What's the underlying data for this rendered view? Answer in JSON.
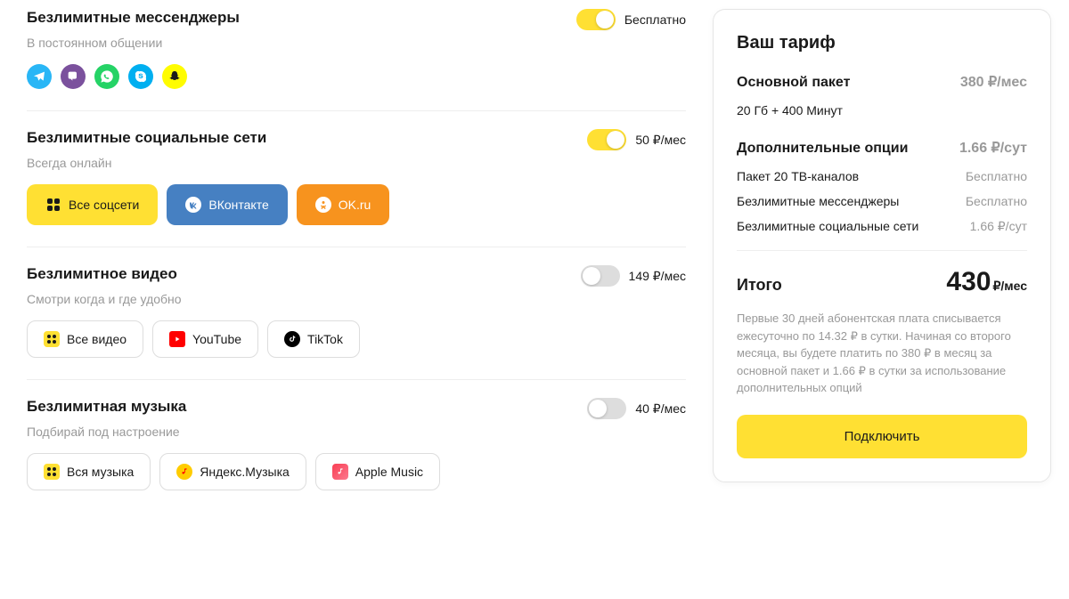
{
  "options": {
    "messengers": {
      "title": "Безлимитные мессенджеры",
      "subtitle": "В постоянном общении",
      "price": "Бесплатно",
      "enabled": true,
      "icons": [
        {
          "name": "telegram",
          "color": "#29b6f6"
        },
        {
          "name": "viber",
          "color": "#7b519d"
        },
        {
          "name": "whatsapp",
          "color": "#25d366"
        },
        {
          "name": "skype",
          "color": "#00aff0"
        },
        {
          "name": "snapchat",
          "color": "#fffc00"
        }
      ]
    },
    "social": {
      "title": "Безлимитные социальные сети",
      "subtitle": "Всегда онлайн",
      "price": "50 ₽/мес",
      "enabled": true,
      "chips": [
        {
          "label": "Все соцсети",
          "style": "yellow"
        },
        {
          "label": "ВКонтакте",
          "style": "blue"
        },
        {
          "label": "OK.ru",
          "style": "orange"
        }
      ]
    },
    "video": {
      "title": "Безлимитное видео",
      "subtitle": "Смотри когда и где удобно",
      "price": "149 ₽/мес",
      "enabled": false,
      "chips": [
        {
          "label": "Все видео",
          "icon": "grid",
          "iconBg": "#ffe033"
        },
        {
          "label": "YouTube",
          "icon": "youtube",
          "iconBg": "#ff0000"
        },
        {
          "label": "TikTok",
          "icon": "tiktok",
          "iconBg": "#000"
        }
      ]
    },
    "music": {
      "title": "Безлимитная музыка",
      "subtitle": "Подбирай под настроение",
      "price": "40 ₽/мес",
      "enabled": false,
      "chips": [
        {
          "label": "Вся музыка",
          "icon": "grid",
          "iconBg": "#ffe033"
        },
        {
          "label": "Яндекс.Музыка",
          "icon": "ymusic",
          "iconBg": "#ffcc00"
        },
        {
          "label": "Apple Music",
          "icon": "amusic",
          "iconBg": "#fa3e54"
        }
      ]
    }
  },
  "tariff": {
    "title": "Ваш тариф",
    "main_package_label": "Основной пакет",
    "main_package_price": "380 ₽/мес",
    "main_package_desc": "20 Гб  +  400 Минут",
    "additional_label": "Дополнительные опции",
    "additional_price": "1.66 ₽/сут",
    "items": [
      {
        "name": "Пакет 20 ТВ-каналов",
        "value": "Бесплатно"
      },
      {
        "name": "Безлимитные мессенджеры",
        "value": "Бесплатно"
      },
      {
        "name": "Безлимитные социальные сети",
        "value": "1.66 ₽/сут"
      }
    ],
    "total_label": "Итого",
    "total_value": "430",
    "total_suffix": "₽/мес",
    "disclaimer": "Первые 30 дней абонентская плата списывается ежесуточно по 14.32 ₽ в сутки. Начиная со второго месяца, вы будете платить по 380 ₽ в месяц за основной пакет и 1.66 ₽ в сутки за использование дополнительных опций",
    "connect_label": "Подключить"
  }
}
